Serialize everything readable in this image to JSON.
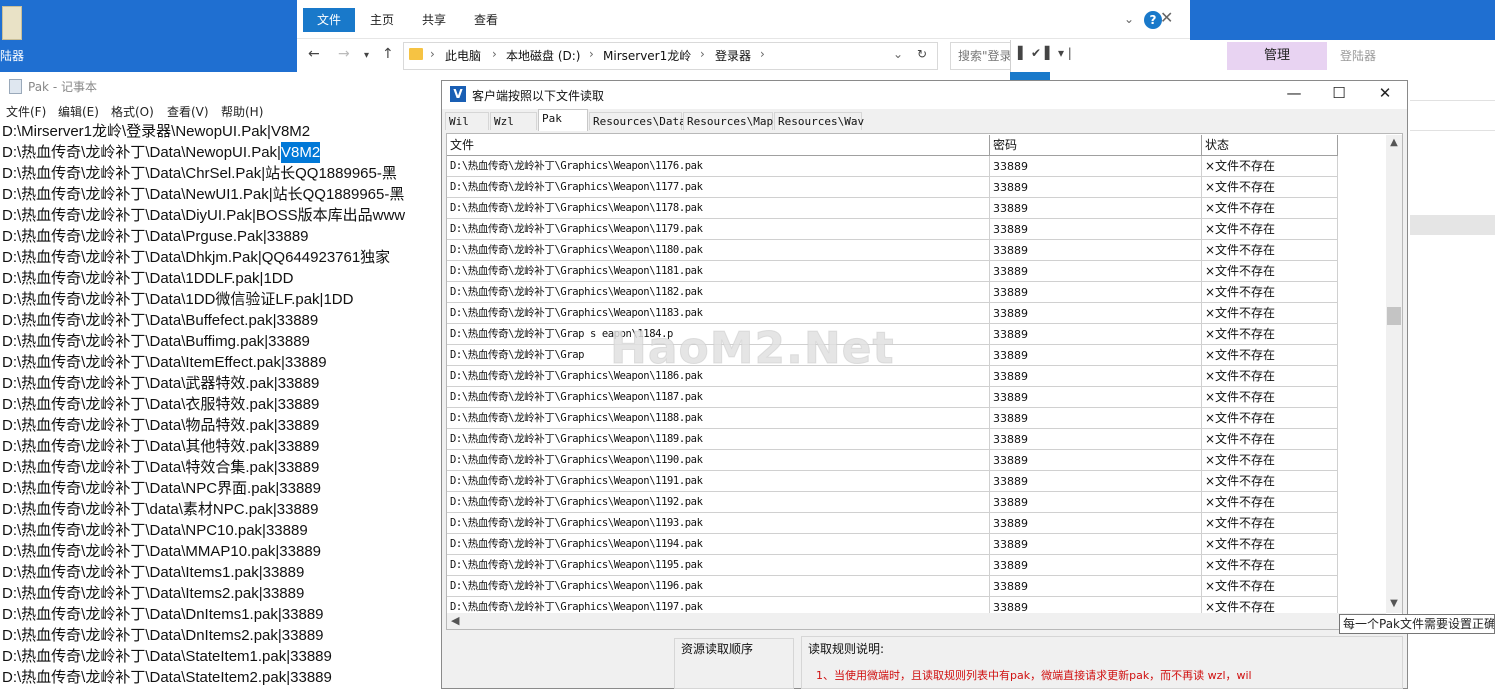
{
  "desktop": {
    "icon_label": "陆器"
  },
  "explorer": {
    "tabs": [
      "文件",
      "主页",
      "共享",
      "查看"
    ],
    "help": "?",
    "breadcrumbs": [
      "此电脑",
      "本地磁盘 (D:)",
      "Mirserver1龙岭",
      "登录器"
    ],
    "search_placeholder": "搜索\"登录器\""
  },
  "explorer2": {
    "quick_access": "▌ ✔ ▌ ▾ |",
    "manage": "管理",
    "title": "登陆器"
  },
  "notepad": {
    "title": "Pak - 记事本",
    "menu": [
      "文件(F)",
      "编辑(E)",
      "格式(O)",
      "查看(V)",
      "帮助(H)"
    ],
    "lines": [
      "D:\\Mirserver1龙岭\\登录器\\NewopUI.Pak|V8M2",
      "D:\\热血传奇\\龙岭补丁\\Data\\NewopUI.Pak|",
      "D:\\热血传奇\\龙岭补丁\\Data\\ChrSel.Pak|站长QQ1889965-黑",
      "D:\\热血传奇\\龙岭补丁\\Data\\NewUI1.Pak|站长QQ1889965-黑",
      "D:\\热血传奇\\龙岭补丁\\Data\\DiyUI.Pak|BOSS版本库出品www",
      "D:\\热血传奇\\龙岭补丁\\Data\\Prguse.Pak|33889",
      "D:\\热血传奇\\龙岭补丁\\Data\\Dhkjm.Pak|QQ644923761独家",
      "D:\\热血传奇\\龙岭补丁\\Data\\1DDLF.pak|1DD",
      "D:\\热血传奇\\龙岭补丁\\Data\\1DD微信验证LF.pak|1DD",
      "D:\\热血传奇\\龙岭补丁\\Data\\Buffefect.pak|33889",
      "D:\\热血传奇\\龙岭补丁\\Data\\Buffimg.pak|33889",
      "D:\\热血传奇\\龙岭补丁\\Data\\ItemEffect.pak|33889",
      "D:\\热血传奇\\龙岭补丁\\Data\\武器特效.pak|33889",
      "D:\\热血传奇\\龙岭补丁\\Data\\衣服特效.pak|33889",
      "D:\\热血传奇\\龙岭补丁\\Data\\物品特效.pak|33889",
      "D:\\热血传奇\\龙岭补丁\\Data\\其他特效.pak|33889",
      "D:\\热血传奇\\龙岭补丁\\Data\\特效合集.pak|33889",
      "D:\\热血传奇\\龙岭补丁\\Data\\NPC界面.pak|33889",
      "D:\\热血传奇\\龙岭补丁\\data\\素材NPC.pak|33889",
      "D:\\热血传奇\\龙岭补丁\\Data\\NPC10.pak|33889",
      "D:\\热血传奇\\龙岭补丁\\Data\\MMAP10.pak|33889",
      "D:\\热血传奇\\龙岭补丁\\Data\\Items1.pak|33889",
      "D:\\热血传奇\\龙岭补丁\\Data\\Items2.pak|33889",
      "D:\\热血传奇\\龙岭补丁\\Data\\DnItems1.pak|33889",
      "D:\\热血传奇\\龙岭补丁\\Data\\DnItems2.pak|33889",
      "D:\\热血传奇\\龙岭补丁\\Data\\StateItem1.pak|33889",
      "D:\\热血传奇\\龙岭补丁\\Data\\StateItem2.pak|33889"
    ],
    "selected_text": "V8M2"
  },
  "dialog": {
    "title": "客户端按照以下文件读取",
    "icon_letter": "V",
    "controls": {
      "minimize": "—",
      "maximize": "☐",
      "close": "✕"
    },
    "tabs": [
      "Wil",
      "Wzl",
      "Pak",
      "Resources\\Data",
      "Resources\\Map",
      "Resources\\Wav"
    ],
    "active_tab": 2,
    "columns": [
      "文件",
      "密码",
      "状态"
    ],
    "rows": [
      [
        "D:\\热血传奇\\龙岭补丁\\Graphics\\Weapon\\1176.pak",
        "33889",
        "×文件不存在"
      ],
      [
        "D:\\热血传奇\\龙岭补丁\\Graphics\\Weapon\\1177.pak",
        "33889",
        "×文件不存在"
      ],
      [
        "D:\\热血传奇\\龙岭补丁\\Graphics\\Weapon\\1178.pak",
        "33889",
        "×文件不存在"
      ],
      [
        "D:\\热血传奇\\龙岭补丁\\Graphics\\Weapon\\1179.pak",
        "33889",
        "×文件不存在"
      ],
      [
        "D:\\热血传奇\\龙岭补丁\\Graphics\\Weapon\\1180.pak",
        "33889",
        "×文件不存在"
      ],
      [
        "D:\\热血传奇\\龙岭补丁\\Graphics\\Weapon\\1181.pak",
        "33889",
        "×文件不存在"
      ],
      [
        "D:\\热血传奇\\龙岭补丁\\Graphics\\Weapon\\1182.pak",
        "33889",
        "×文件不存在"
      ],
      [
        "D:\\热血传奇\\龙岭补丁\\Graphics\\Weapon\\1183.pak",
        "33889",
        "×文件不存在"
      ],
      [
        "D:\\热血传奇\\龙岭补丁\\Grap  s  eapon\\1184.p",
        "33889",
        "×文件不存在"
      ],
      [
        "D:\\热血传奇\\龙岭补丁\\Grap",
        "33889",
        "×文件不存在"
      ],
      [
        "D:\\热血传奇\\龙岭补丁\\Graphics\\Weapon\\1186.pak",
        "33889",
        "×文件不存在"
      ],
      [
        "D:\\热血传奇\\龙岭补丁\\Graphics\\Weapon\\1187.pak",
        "33889",
        "×文件不存在"
      ],
      [
        "D:\\热血传奇\\龙岭补丁\\Graphics\\Weapon\\1188.pak",
        "33889",
        "×文件不存在"
      ],
      [
        "D:\\热血传奇\\龙岭补丁\\Graphics\\Weapon\\1189.pak",
        "33889",
        "×文件不存在"
      ],
      [
        "D:\\热血传奇\\龙岭补丁\\Graphics\\Weapon\\1190.pak",
        "33889",
        "×文件不存在"
      ],
      [
        "D:\\热血传奇\\龙岭补丁\\Graphics\\Weapon\\1191.pak",
        "33889",
        "×文件不存在"
      ],
      [
        "D:\\热血传奇\\龙岭补丁\\Graphics\\Weapon\\1192.pak",
        "33889",
        "×文件不存在"
      ],
      [
        "D:\\热血传奇\\龙岭补丁\\Graphics\\Weapon\\1193.pak",
        "33889",
        "×文件不存在"
      ],
      [
        "D:\\热血传奇\\龙岭补丁\\Graphics\\Weapon\\1194.pak",
        "33889",
        "×文件不存在"
      ],
      [
        "D:\\热血传奇\\龙岭补丁\\Graphics\\Weapon\\1195.pak",
        "33889",
        "×文件不存在"
      ],
      [
        "D:\\热血传奇\\龙岭补丁\\Graphics\\Weapon\\1196.pak",
        "33889",
        "×文件不存在"
      ],
      [
        "D:\\热血传奇\\龙岭补丁\\Graphics\\Weapon\\1197.pak",
        "33889",
        "×文件不存在"
      ]
    ],
    "tooltip": "每一个Pak文件需要设置正确",
    "order_label": "资源读取顺序",
    "rules_label": "读取规则说明:",
    "rules_text": "1、当使用微端时，且读取规则列表中有pak，微端直接请求更新pak，而不再读 wzl，wil"
  },
  "watermark": "HaoM2.Net"
}
